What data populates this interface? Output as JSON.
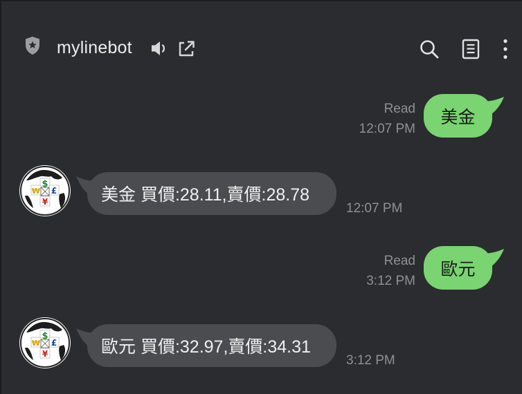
{
  "header": {
    "title": "mylinebot",
    "icons": {
      "shield": "shield-star-icon",
      "speaker": "speaker-icon",
      "popout": "external-link-icon",
      "search": "search-icon",
      "notes": "notes-icon",
      "more": "more-vertical-icon"
    }
  },
  "colors": {
    "background": "#2b2c2f",
    "outgoing_bubble": "#79d471",
    "incoming_bubble": "#4b4c50",
    "meta_text": "#8f9094"
  },
  "messages": [
    {
      "direction": "outgoing",
      "text": "美金",
      "status": "Read",
      "time": "12:07 PM"
    },
    {
      "direction": "incoming",
      "text": "美金 買價:28.11,賣價:28.78",
      "time": "12:07 PM"
    },
    {
      "direction": "outgoing",
      "text": "歐元",
      "status": "Read",
      "time": "3:12 PM"
    },
    {
      "direction": "incoming",
      "text": "歐元 買價:32.97,賣價:34.31",
      "time": "3:12 PM"
    }
  ],
  "avatar": {
    "icon": "currency-globe-avatar",
    "symbols": [
      "$",
      "₩",
      "£",
      "¥"
    ]
  }
}
